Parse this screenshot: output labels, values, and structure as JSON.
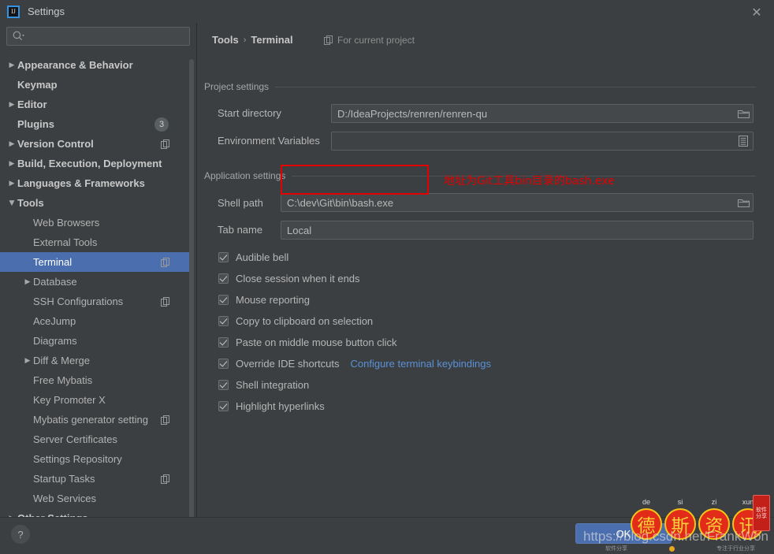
{
  "window": {
    "title": "Settings",
    "logo_text": "IJ",
    "close_label": "✕"
  },
  "sidebar": {
    "search": {
      "placeholder": "",
      "value": ""
    },
    "items": [
      {
        "label": "Appearance & Behavior",
        "level": 0,
        "arrow": "▶",
        "expanded": false,
        "selected": false
      },
      {
        "label": "Keymap",
        "level": 0,
        "arrow": "",
        "expanded": false,
        "selected": false
      },
      {
        "label": "Editor",
        "level": 0,
        "arrow": "▶",
        "expanded": false,
        "selected": false
      },
      {
        "label": "Plugins",
        "level": 0,
        "arrow": "",
        "expanded": false,
        "selected": false,
        "badge": "3"
      },
      {
        "label": "Version Control",
        "level": 0,
        "arrow": "▶",
        "expanded": false,
        "selected": false,
        "copy_icon": true
      },
      {
        "label": "Build, Execution, Deployment",
        "level": 0,
        "arrow": "▶",
        "expanded": false,
        "selected": false
      },
      {
        "label": "Languages & Frameworks",
        "level": 0,
        "arrow": "▶",
        "expanded": false,
        "selected": false
      },
      {
        "label": "Tools",
        "level": 0,
        "arrow": "▼",
        "expanded": true,
        "selected": false
      },
      {
        "label": "Web Browsers",
        "level": 1,
        "arrow": "",
        "selected": false
      },
      {
        "label": "External Tools",
        "level": 1,
        "arrow": "",
        "selected": false
      },
      {
        "label": "Terminal",
        "level": 1,
        "arrow": "",
        "selected": true,
        "copy_icon": true
      },
      {
        "label": "Database",
        "level": 1,
        "arrow": "▶",
        "selected": false
      },
      {
        "label": "SSH Configurations",
        "level": 1,
        "arrow": "",
        "selected": false,
        "copy_icon": true
      },
      {
        "label": "AceJump",
        "level": 1,
        "arrow": "",
        "selected": false
      },
      {
        "label": "Diagrams",
        "level": 1,
        "arrow": "",
        "selected": false
      },
      {
        "label": "Diff & Merge",
        "level": 1,
        "arrow": "▶",
        "selected": false
      },
      {
        "label": "Free Mybatis",
        "level": 1,
        "arrow": "",
        "selected": false
      },
      {
        "label": "Key Promoter X",
        "level": 1,
        "arrow": "",
        "selected": false
      },
      {
        "label": "Mybatis generator setting",
        "level": 1,
        "arrow": "",
        "selected": false,
        "copy_icon": true
      },
      {
        "label": "Server Certificates",
        "level": 1,
        "arrow": "",
        "selected": false
      },
      {
        "label": "Settings Repository",
        "level": 1,
        "arrow": "",
        "selected": false
      },
      {
        "label": "Startup Tasks",
        "level": 1,
        "arrow": "",
        "selected": false,
        "copy_icon": true
      },
      {
        "label": "Web Services",
        "level": 1,
        "arrow": "",
        "selected": false
      },
      {
        "label": "Other Settings",
        "level": 0,
        "arrow": "▶",
        "selected": false
      }
    ]
  },
  "main": {
    "breadcrumb": {
      "parent": "Tools",
      "separator": "›",
      "current": "Terminal"
    },
    "for_current_project": "For current project",
    "project_settings": {
      "group_title": "Project settings",
      "start_directory_label": "Start directory",
      "start_directory_value": "D:/IdeaProjects/renren/renren-qu",
      "environment_variables_label": "Environment Variables",
      "environment_variables_value": ""
    },
    "application_settings": {
      "group_title": "Application settings",
      "shell_path_label": "Shell path",
      "shell_path_value": "C:\\dev\\Git\\bin\\bash.exe",
      "tab_name_label": "Tab name",
      "tab_name_value": "Local",
      "checkboxes": [
        {
          "label": "Audible bell",
          "checked": true
        },
        {
          "label": "Close session when it ends",
          "checked": true
        },
        {
          "label": "Mouse reporting",
          "checked": true
        },
        {
          "label": "Copy to clipboard on selection",
          "checked": true
        },
        {
          "label": "Paste on middle mouse button click",
          "checked": true
        },
        {
          "label": "Override IDE shortcuts",
          "checked": true,
          "link": "Configure terminal keybindings"
        },
        {
          "label": "Shell integration",
          "checked": true
        },
        {
          "label": "Highlight hyperlinks",
          "checked": true
        }
      ]
    }
  },
  "annotation": {
    "red_note": "地址为Git工具bin目录的bash.exe",
    "red_color": "#e40000"
  },
  "footer": {
    "help_label": "?",
    "ok_label": "OK"
  },
  "watermark": {
    "url": "https://blog.csdn.net/FrankWon",
    "coins": [
      {
        "char": "德",
        "pinyin": "de"
      },
      {
        "char": "斯",
        "pinyin": "si"
      },
      {
        "char": "资",
        "pinyin": "zi"
      },
      {
        "char": "讯",
        "pinyin": "xun"
      }
    ],
    "stamp": "软件分享",
    "sub_left": "软件分享",
    "sub_right": "专注于行业分享"
  }
}
